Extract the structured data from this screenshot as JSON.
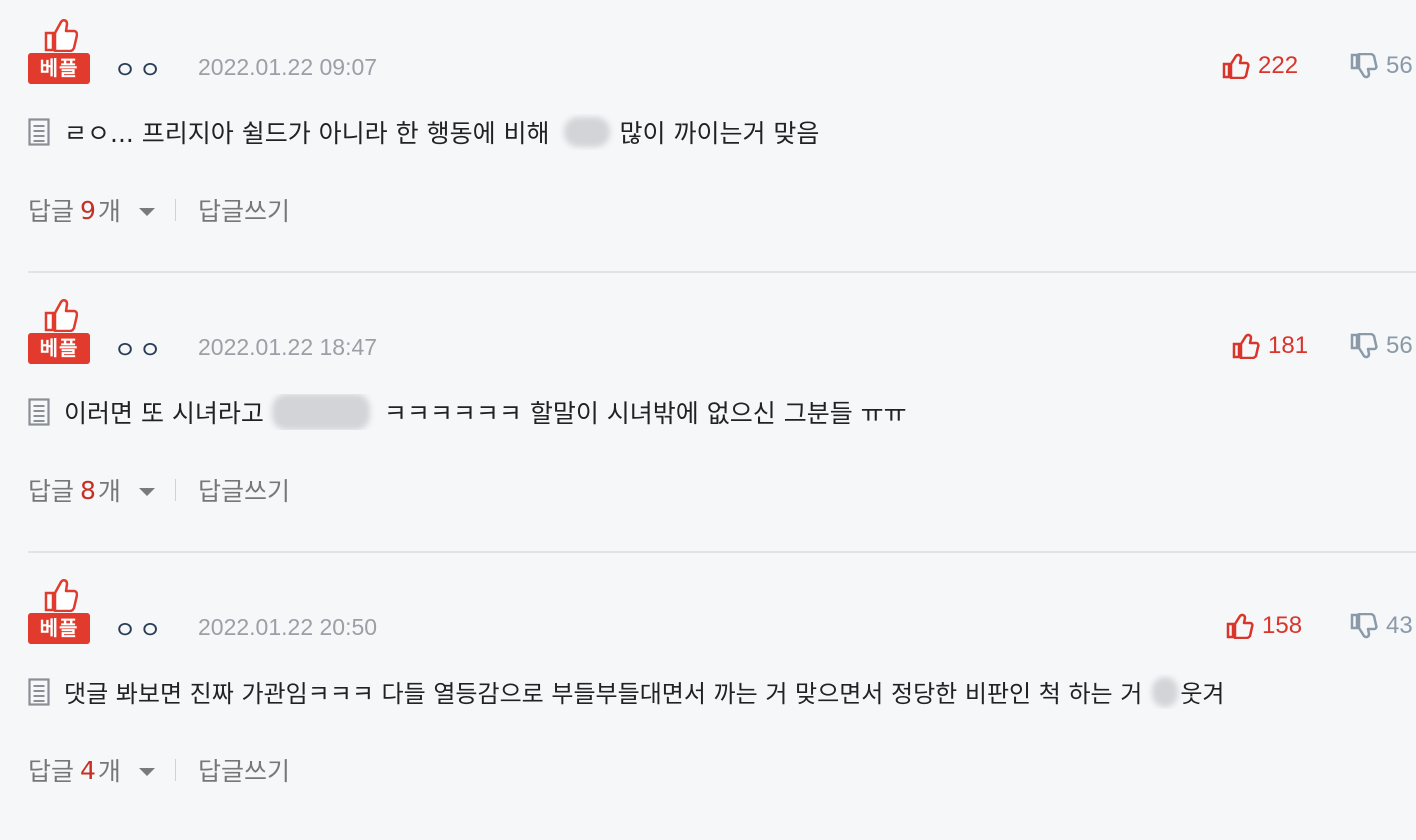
{
  "badge_label": "베플",
  "reply_label": "답글",
  "reply_unit": "개",
  "write_reply_label": "답글쓰기",
  "colors": {
    "accent": "#e23a2c",
    "like": "#d9352a",
    "dislike": "#8a9aa8",
    "background": "#f6f7f9"
  },
  "comments": [
    {
      "nickname": "ㅇㅇ",
      "date": "2022.01.22 09:07",
      "likes": "222",
      "dislikes": "56",
      "text_before": "ㄹㅇ... 프리지아 쉴드가 아니라 한 행동에 비해",
      "text_after": "많이 까이는거 맞음",
      "reply_count": "9"
    },
    {
      "nickname": "ㅇㅇ",
      "date": "2022.01.22 18:47",
      "likes": "181",
      "dislikes": "56",
      "text_before": "이러면 또 시녀라고",
      "text_after": "ㅋㅋㅋㅋㅋㅋ 할말이 시녀밖에 없으신 그분들 ㅠㅠ",
      "reply_count": "8"
    },
    {
      "nickname": "ㅇㅇ",
      "date": "2022.01.22 20:50",
      "likes": "158",
      "dislikes": "43",
      "text_before": "댓글 봐보면 진짜 가관임ㅋㅋㅋ 다들 열등감으로 부들부들대면서 까는 거 맞으면서 정당한 비판인 척 하는 거",
      "text_after": "웃겨",
      "reply_count": "4"
    }
  ]
}
